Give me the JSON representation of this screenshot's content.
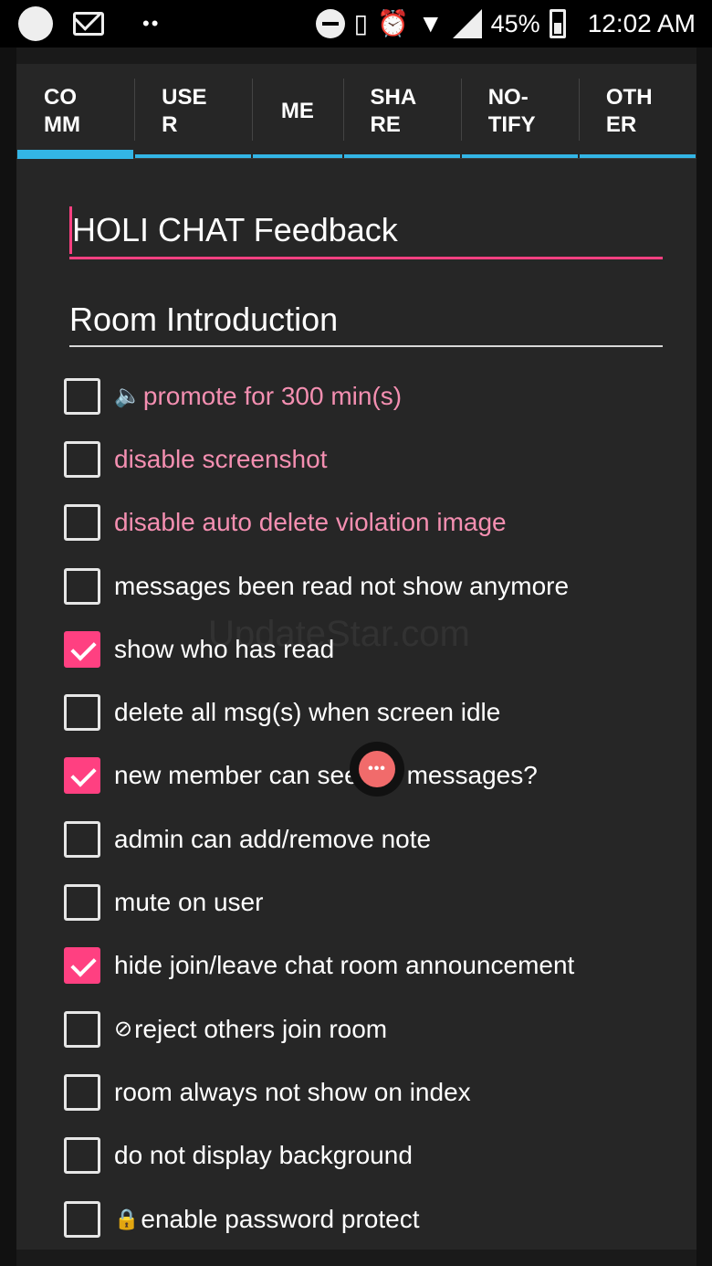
{
  "status_bar": {
    "battery": "45%",
    "time": "12:02 AM",
    "icons": [
      "circle-icon",
      "gmail-icon",
      "more-dots-icon",
      "dnd-icon",
      "vibrate-icon",
      "alarm-icon",
      "wifi-icon",
      "signal-icon",
      "battery-charging-icon"
    ]
  },
  "tabs": [
    {
      "label": "CO\nMM",
      "active": true
    },
    {
      "label": "USE\nR"
    },
    {
      "label": "ME"
    },
    {
      "label": "SHA\nRE"
    },
    {
      "label": "NO-\nTIFY"
    },
    {
      "label": "OTH\nER"
    }
  ],
  "title_field": {
    "value": "HOLI CHAT Feedback"
  },
  "intro_field": {
    "value": "Room Introduction"
  },
  "options": [
    {
      "label": "promote for 300 min(s)",
      "checked": false,
      "pink": true,
      "icon": "speaker-icon"
    },
    {
      "label": "disable screenshot",
      "checked": false,
      "pink": true
    },
    {
      "label": "disable auto delete violation image",
      "checked": false,
      "pink": true
    },
    {
      "label": "messages been read not show anymore",
      "checked": false
    },
    {
      "label": "show who has read",
      "checked": true
    },
    {
      "label": "delete all msg(s) when screen idle",
      "checked": false
    },
    {
      "label": "new member can see old messages?",
      "checked": true
    },
    {
      "label": "admin can add/remove note",
      "checked": false
    },
    {
      "label": "mute on user",
      "checked": false
    },
    {
      "label": "hide join/leave chat room announcement",
      "checked": true
    },
    {
      "label": "reject others join room",
      "checked": false,
      "icon": "block-icon"
    },
    {
      "label": "room always not show on index",
      "checked": false
    },
    {
      "label": "do not display background",
      "checked": false
    },
    {
      "label": "enable password protect",
      "checked": false,
      "icon": "lock-icon"
    }
  ],
  "colors": {
    "accent": "#ff4081",
    "tab_indicator": "#33b5e5",
    "pink_text": "#f48fb1",
    "dialog_bg": "#262626"
  },
  "watermark": "UpdateStar.com"
}
